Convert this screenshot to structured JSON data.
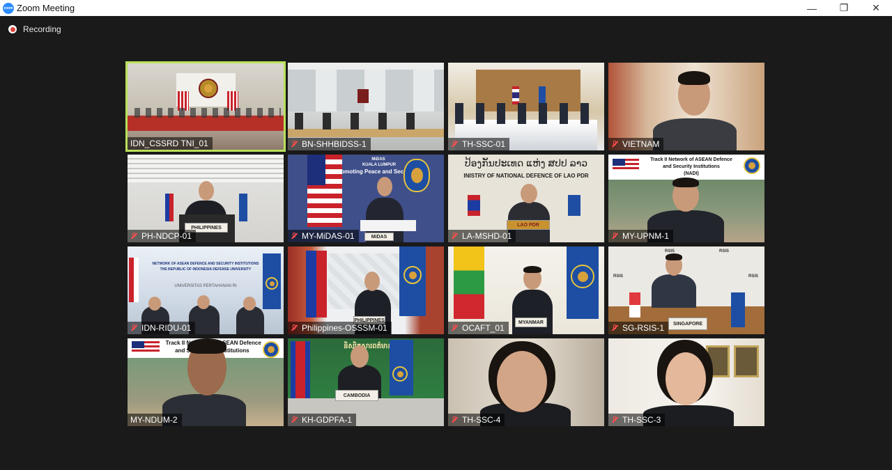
{
  "window": {
    "app_icon_text": "zoom",
    "title": "Zoom Meeting",
    "minimize_glyph": "—",
    "restore_glyph": "❐",
    "close_glyph": "✕"
  },
  "recording": {
    "label": "Recording"
  },
  "banners": {
    "midas_top": "MiDAS",
    "midas_city": "KUALA LUMPUR",
    "midas_slogan": "\"Promoting Peace and Security\"",
    "midas_placard": "MiDAS",
    "lao_script": "ປ້ອງກັນປະເທດ ແຫ່ງ ສປປ ລາວ",
    "lao_ministry": "INISTRY OF NATIONAL DEFENCE OF LAO PDR",
    "lao_placard": "LAO PDR",
    "nadi_title": "Track II Network of ASEAN Defence",
    "nadi_title2": "and Security Institutions",
    "nadi_abbr": "(NADI)",
    "ridu_title": "NETWORK OF ASEAN DEFENCE AND SECURITY INSTITUTIONS",
    "ridu_title2": "THE REPUBLIC OF INDONESIA DEFENSE UNIVERSITY",
    "ridu_building": "UNIVERSITAS PERTAHANAN RI",
    "philippines_placard": "PHILIPPINES",
    "osssm_placard": "PHILIPPINES",
    "myanmar_placard": "MYANMAR",
    "rsis": "RSIS",
    "singapore_placard": "SINGAPORE",
    "ndum_title": "Track II Net",
    "ndum_title_b": "SEAN Defence",
    "ndum_title2": "and S",
    "ndum_title2_b": "Institutions",
    "khmer_text": "និស្សិតសារពត៌មាន",
    "khmer_placard": "CAMBODIA"
  },
  "participants": [
    {
      "name": "IDN_CSSRD TNI_01",
      "muted": false,
      "active": true
    },
    {
      "name": "BN-SHHBIDSS-1",
      "muted": true,
      "active": false
    },
    {
      "name": "TH-SSC-01",
      "muted": true,
      "active": false
    },
    {
      "name": "VIETNAM",
      "muted": true,
      "active": false
    },
    {
      "name": "PH-NDCP-01",
      "muted": true,
      "active": false
    },
    {
      "name": "MY-MiDAS-01",
      "muted": true,
      "active": false
    },
    {
      "name": "LA-MSHD-01",
      "muted": true,
      "active": false
    },
    {
      "name": "MY-UPNM-1",
      "muted": true,
      "active": false
    },
    {
      "name": "IDN-RIDU-01",
      "muted": true,
      "active": false
    },
    {
      "name": "Philippines-OSSSM-01",
      "muted": true,
      "active": false
    },
    {
      "name": "OCAFT_01",
      "muted": true,
      "active": false
    },
    {
      "name": "SG-RSIS-1",
      "muted": true,
      "active": false
    },
    {
      "name": "MY-NDUM-2",
      "muted": false,
      "active": false
    },
    {
      "name": "KH-GDPFA-1",
      "muted": true,
      "active": false
    },
    {
      "name": "TH-SSC-4",
      "muted": true,
      "active": false
    },
    {
      "name": "TH-SSC-3",
      "muted": true,
      "active": false
    }
  ]
}
